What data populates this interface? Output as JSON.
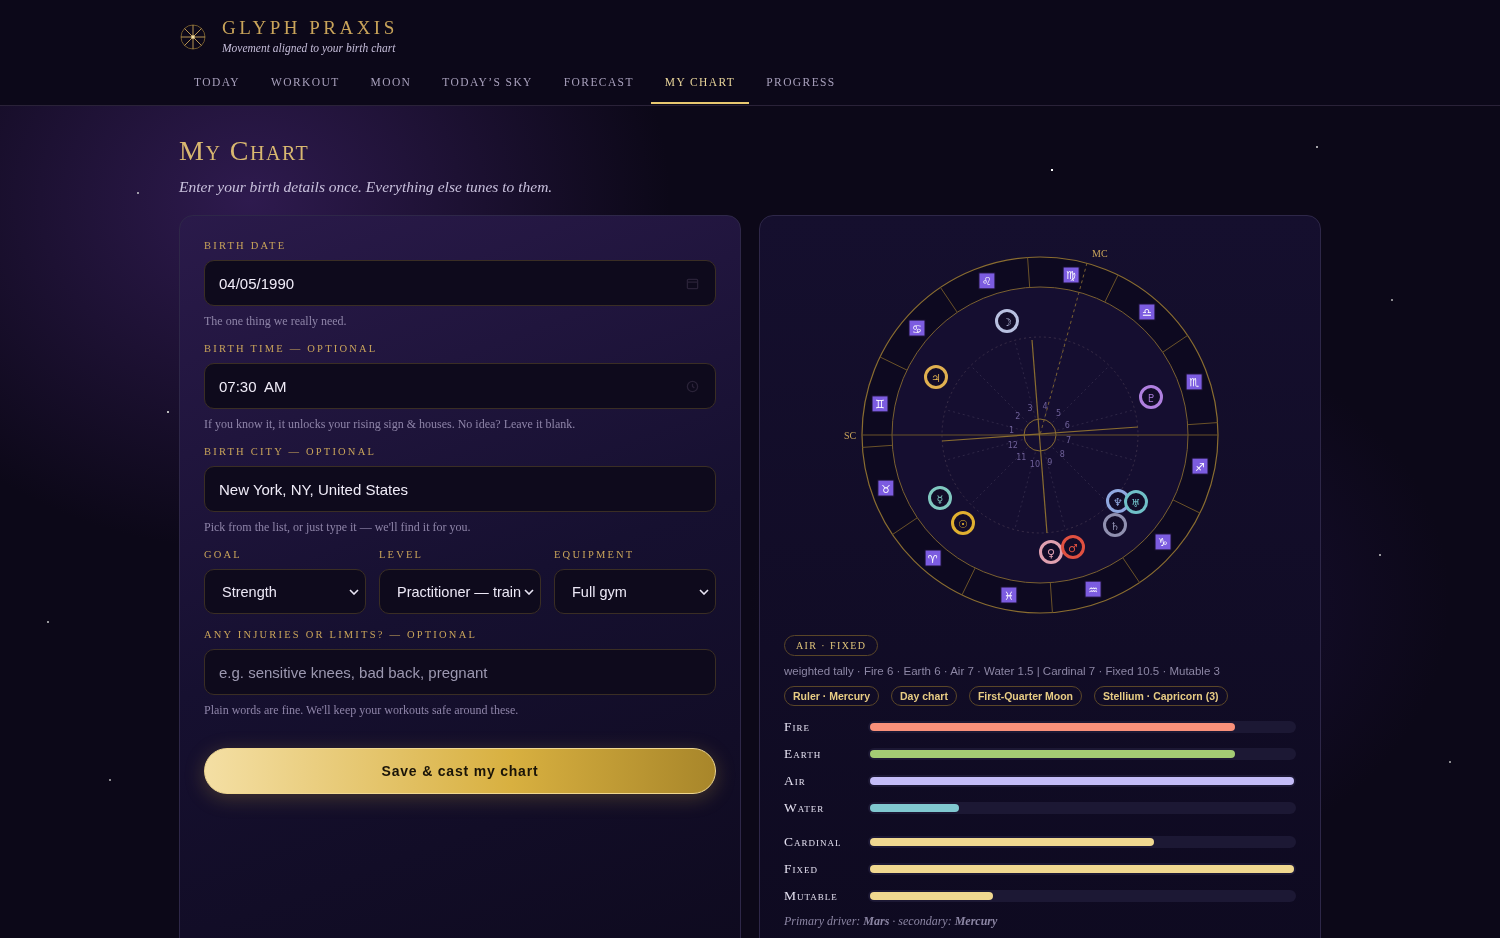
{
  "brand": {
    "name": "GLYPH PRAXIS",
    "tagline": "Movement aligned to your birth chart"
  },
  "nav": [
    {
      "label": "TODAY",
      "selected": false
    },
    {
      "label": "WORKOUT",
      "selected": false
    },
    {
      "label": "MOON",
      "selected": false
    },
    {
      "label": "TODAY’S SKY",
      "selected": false
    },
    {
      "label": "FORECAST",
      "selected": false
    },
    {
      "label": "MY CHART",
      "selected": true
    },
    {
      "label": "PROGRESS",
      "selected": false
    }
  ],
  "page": {
    "title": "My Chart",
    "subtitle": "Enter your birth details once. Everything else tunes to them."
  },
  "form": {
    "fields": [
      {
        "kind": "date",
        "label": "BIRTH DATE",
        "value": "04/05/1990",
        "hint": "The one thing we really need."
      },
      {
        "kind": "time",
        "label": "BIRTH TIME — OPTIONAL",
        "value": "07:30  AM",
        "hint": "If you know it, it unlocks your rising sign & houses. No idea? Leave it blank."
      },
      {
        "kind": "text",
        "label": "BIRTH CITY — OPTIONAL",
        "value": "New York, NY, United States",
        "hint": "Pick from the list, or just type it — we'll find it for you."
      }
    ],
    "selects": [
      {
        "label": "GOAL",
        "value": "Strength"
      },
      {
        "label": "LEVEL",
        "value": "Practitioner — train"
      },
      {
        "label": "EQUIPMENT",
        "value": "Full gym"
      }
    ],
    "injuries": {
      "label": "ANY INJURIES OR LIMITS? — OPTIONAL",
      "placeholder": "e.g. sensitive knees, bad back, pregnant",
      "hint": "Plain words are fine. We'll keep your workouts safe around these."
    },
    "submit": "Save & cast my chart"
  },
  "chart": {
    "axis_labels": [
      "MC",
      "SC"
    ],
    "signs": [
      "♈",
      "♉",
      "♊",
      "♋",
      "♌",
      "♍",
      "♎",
      "♏",
      "♐",
      "♑",
      "♒",
      "♓"
    ],
    "house_numbers": [
      "1",
      "2",
      "3",
      "4",
      "5",
      "6",
      "7",
      "8",
      "9",
      "10",
      "11",
      "12"
    ],
    "planets": [
      {
        "glyph": "☽",
        "color": "#b8c0e0"
      },
      {
        "glyph": "♃",
        "color": "#e0b050"
      },
      {
        "glyph": "♇",
        "color": "#b080e0"
      },
      {
        "glyph": "☿",
        "color": "#80c8c0"
      },
      {
        "glyph": "☉",
        "color": "#e0b030"
      },
      {
        "glyph": "♆",
        "color": "#90a8e0"
      },
      {
        "glyph": "♅",
        "color": "#70c0c8"
      },
      {
        "glyph": "♄",
        "color": "#9090b0"
      },
      {
        "glyph": "♀",
        "color": "#e0a0b0"
      },
      {
        "glyph": "♂",
        "color": "#e05040"
      }
    ]
  },
  "summary": {
    "signature": "AIR · FIXED",
    "tally": "weighted tally · Fire 6 · Earth 6 · Air 7 · Water 1.5 | Cardinal 7 · Fixed 10.5 · Mutable 3",
    "chips": [
      "Ruler · Mercury",
      "Day chart",
      "First-Quarter Moon",
      "Stellium · Capricorn (3)"
    ],
    "elements": [
      {
        "label": "Fire",
        "level": 0.86,
        "color": "#f9907a"
      },
      {
        "label": "Earth",
        "level": 0.86,
        "color": "#a4cc74"
      },
      {
        "label": "Air",
        "level": 1.0,
        "color": "#c4bcf8"
      },
      {
        "label": "Water",
        "level": 0.21,
        "color": "#80c8d0"
      }
    ],
    "modalities": [
      {
        "label": "Cardinal",
        "level": 0.67,
        "color": "#f0d890"
      },
      {
        "label": "Fixed",
        "level": 1.0,
        "color": "#f0d890"
      },
      {
        "label": "Mutable",
        "level": 0.29,
        "color": "#f0d890"
      }
    ],
    "note": "Primary driver: **Mars** · secondary: **Mercury**"
  }
}
